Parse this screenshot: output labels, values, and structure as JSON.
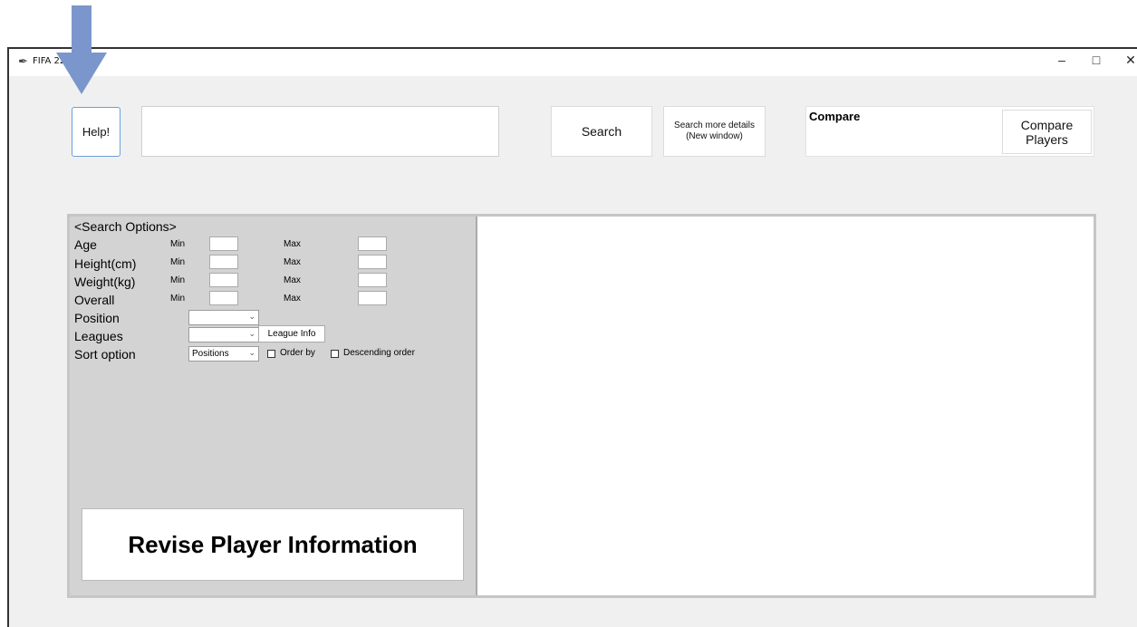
{
  "window": {
    "title": "FIFA 22 N",
    "minimize": "–",
    "maximize": "□",
    "close": "✕"
  },
  "toolbar": {
    "help_label": "Help!",
    "search_value": "",
    "search_label": "Search",
    "more_details_label": "Search more details\n(New window)",
    "compare_title": "Compare",
    "compare_button_label": "Compare\nPlayers"
  },
  "search_options": {
    "header": "<Search Options>",
    "rows": [
      {
        "label": "Age",
        "min_label": "Min",
        "max_label": "Max",
        "min_value": "",
        "max_value": ""
      },
      {
        "label": "Height(cm)",
        "min_label": "Min",
        "max_label": "Max",
        "min_value": "",
        "max_value": ""
      },
      {
        "label": "Weight(kg)",
        "min_label": "Min",
        "max_label": "Max",
        "min_value": "",
        "max_value": ""
      },
      {
        "label": "Overall",
        "min_label": "Min",
        "max_label": "Max",
        "min_value": "",
        "max_value": ""
      }
    ],
    "position_label": "Position",
    "position_value": "",
    "leagues_label": "Leagues",
    "leagues_value": "",
    "league_info_label": "League Info",
    "sort_label": "Sort option",
    "sort_value": "Positions",
    "order_by_label": "Order by",
    "descending_label": "Descending order",
    "revise_label": "Revise Player Information"
  },
  "colors": {
    "annotation_arrow": "#7b96cc",
    "help_border": "#6a9fdc"
  },
  "icons": {
    "app": "feather-icon",
    "dropdown": "chevron-down-icon"
  }
}
